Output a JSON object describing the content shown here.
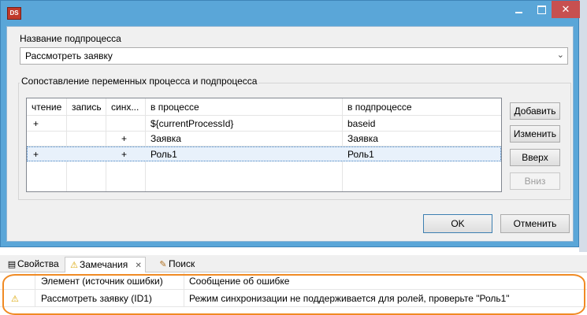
{
  "dialog": {
    "app_icon": "DS",
    "win_minimize": "",
    "win_maximize": "",
    "win_close": "✕",
    "subprocess_label": "Название подпроцесса",
    "subprocess_value": "Рассмотреть заявку",
    "mapping_label": "Сопоставление переменных процесса и подпроцесса",
    "table": {
      "headers": [
        "чтение",
        "запись",
        "синх...",
        "в процессе",
        "в подпроцессе"
      ],
      "rows": [
        [
          "+",
          "",
          "",
          "${currentProcessId}",
          "baseid"
        ],
        [
          "",
          "",
          "+",
          "Заявка",
          "Заявка"
        ],
        [
          "+",
          "",
          "+",
          "Роль1",
          "Роль1"
        ]
      ],
      "selected_row": 2
    },
    "side_buttons": {
      "add": "Добавить",
      "edit": "Изменить",
      "up": "Вверх",
      "down": "Вниз"
    },
    "ok": "OK",
    "cancel": "Отменить"
  },
  "bottom": {
    "tabs": [
      {
        "label": "Свойства",
        "icon": "properties-icon"
      },
      {
        "label": "Замечания",
        "icon": "warning-icon",
        "close": "✕"
      },
      {
        "label": "Поиск",
        "icon": "search-icon"
      }
    ],
    "columns": [
      "Элемент (источник ошибки)",
      "Сообщение об ошибке"
    ],
    "rows": [
      {
        "element": "Рассмотреть заявку (ID1)",
        "message": "Режим синхронизации не поддерживается для ролей, проверьте \"Роль1\""
      }
    ]
  },
  "colors": {
    "titlebar": "#5aa6d8",
    "highlight": "#f08a24",
    "selection": "#e8f1fb"
  }
}
